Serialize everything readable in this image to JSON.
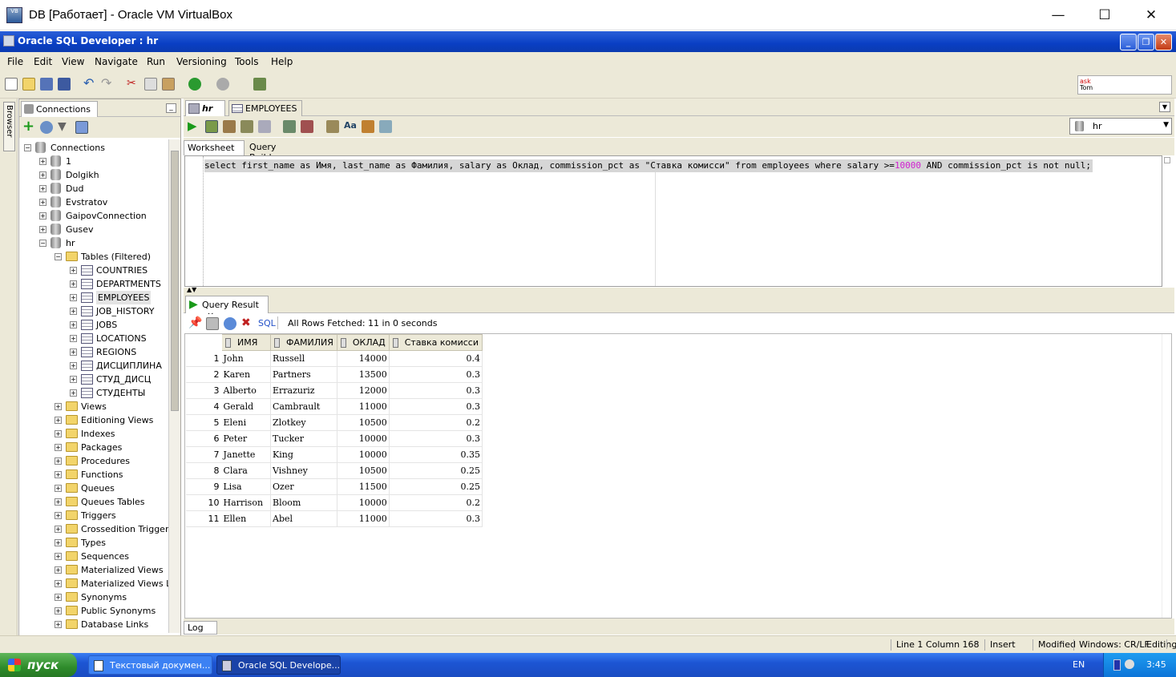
{
  "vbox": {
    "title": "DB [Работает] - Oracle VM VirtualBox",
    "minimize": "—",
    "maximize": "☐",
    "close": "✕"
  },
  "app": {
    "title": "Oracle SQL Developer : hr"
  },
  "menu": [
    "File",
    "Edit",
    "View",
    "Navigate",
    "Run",
    "Versioning",
    "Tools",
    "Help"
  ],
  "ask_box": {
    "line1": "ask",
    "line2": "Tom"
  },
  "browser_tab": "Browser",
  "connections": {
    "tab_label": "Connections",
    "root": "Connections",
    "items": [
      "1",
      "Dolgikh",
      "Dud",
      "Evstratov",
      "GaipovConnection",
      "Gusev",
      "hr"
    ],
    "tables_folder": "Tables (Filtered)",
    "tables": [
      "COUNTRIES",
      "DEPARTMENTS",
      "EMPLOYEES",
      "JOB_HISTORY",
      "JOBS",
      "LOCATIONS",
      "REGIONS",
      "ДИСЦИПЛИНА",
      "СТУД_ДИСЦ",
      "СТУДЕНТЫ"
    ],
    "folders": [
      "Views",
      "Editioning Views",
      "Indexes",
      "Packages",
      "Procedures",
      "Functions",
      "Queues",
      "Queues Tables",
      "Triggers",
      "Crossedition Triggers",
      "Types",
      "Sequences",
      "Materialized Views",
      "Materialized Views Logs",
      "Synonyms",
      "Public Synonyms",
      "Database Links"
    ]
  },
  "editor": {
    "tabs": [
      "hr",
      "EMPLOYEES"
    ],
    "connection": "hr",
    "subtabs": [
      "Worksheet",
      "Query Builder"
    ],
    "sql_a": "select first_name as Имя, last_name as Фамилия, salary as Оклад, commission_pct as \"Ставка комисси\" from employees where salary >=",
    "sql_num": "10000",
    "sql_b": " AND commission_pct is not null;"
  },
  "result": {
    "tab_label": "Query Result",
    "sql_link": "SQL",
    "status": "All Rows Fetched: 11 in 0 seconds",
    "columns": [
      "ИМЯ",
      "ФАМИЛИЯ",
      "ОКЛАД",
      "Ставка комисси"
    ],
    "rows": [
      [
        "1",
        "John",
        "Russell",
        "14000",
        "0.4"
      ],
      [
        "2",
        "Karen",
        "Partners",
        "13500",
        "0.3"
      ],
      [
        "3",
        "Alberto",
        "Errazuriz",
        "12000",
        "0.3"
      ],
      [
        "4",
        "Gerald",
        "Cambrault",
        "11000",
        "0.3"
      ],
      [
        "5",
        "Eleni",
        "Zlotkey",
        "10500",
        "0.2"
      ],
      [
        "6",
        "Peter",
        "Tucker",
        "10000",
        "0.3"
      ],
      [
        "7",
        "Janette",
        "King",
        "10000",
        "0.35"
      ],
      [
        "8",
        "Clara",
        "Vishney",
        "10500",
        "0.25"
      ],
      [
        "9",
        "Lisa",
        "Ozer",
        "11500",
        "0.25"
      ],
      [
        "10",
        "Harrison",
        "Bloom",
        "10000",
        "0.2"
      ],
      [
        "11",
        "Ellen",
        "Abel",
        "11000",
        "0.3"
      ]
    ]
  },
  "log_tab": "Log",
  "statusbar": {
    "position": "Line 1 Column 168",
    "mode": "Insert",
    "modified": "Modified",
    "eol": "Windows: CR/LF",
    "edit": "Editing"
  },
  "taskbar": {
    "start": "пуск",
    "tasks": [
      "Текстовый докумен...",
      "Oracle SQL Develope..."
    ],
    "lang": "EN",
    "clock": "3:45"
  },
  "colors": {
    "title_blue": "#0a3fc4",
    "taskbar": "#1d55d4",
    "start_green": "#2e8b2b",
    "sql_number": "#d020d0"
  }
}
